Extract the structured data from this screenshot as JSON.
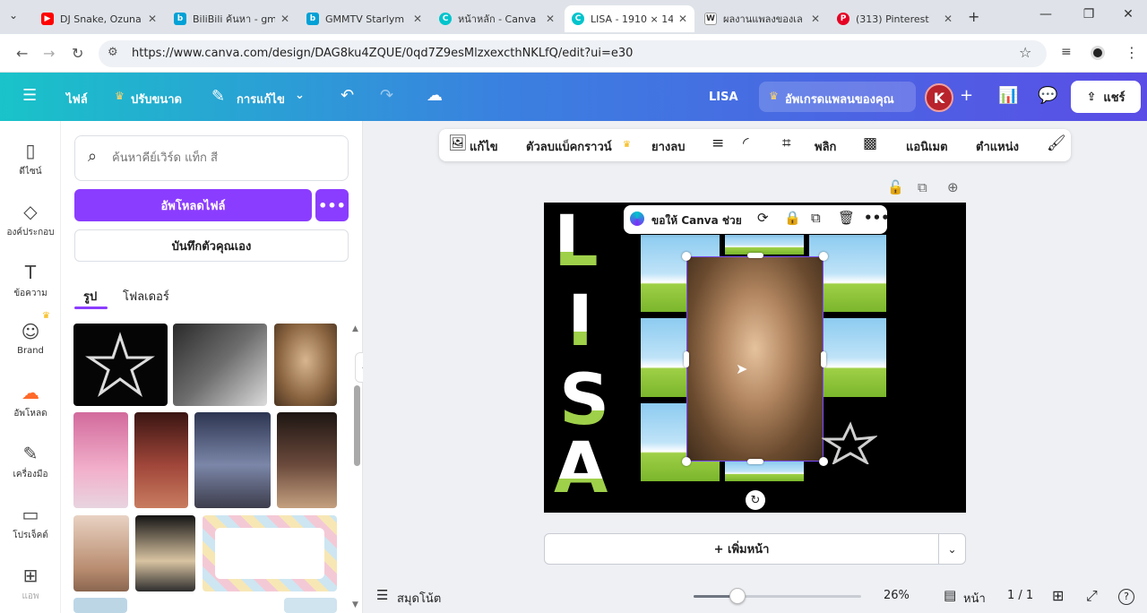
{
  "browser": {
    "tabs": [
      {
        "title": "DJ Snake, Ozuna",
        "color": "#ff0000",
        "glyph": "▶"
      },
      {
        "title": "BiliBili ค้นหา - gm",
        "color": "#00a1d6",
        "glyph": "b"
      },
      {
        "title": "GMMTV Starlym",
        "color": "#00a1d6",
        "glyph": "b"
      },
      {
        "title": "หน้าหลัก - Canva",
        "color": "#00c4cc",
        "glyph": "C"
      },
      {
        "title": "LISA - 1910 × 14",
        "color": "#00c4cc",
        "glyph": "C",
        "active": true
      },
      {
        "title": "ผลงานแพลงของเล",
        "color": "#444444",
        "glyph": "W"
      },
      {
        "title": "(313) Pinterest",
        "color": "#e60023",
        "glyph": "P"
      }
    ],
    "url": "https://www.canva.com/design/DAG8ku4ZQUE/0qd7Z9esMlzxexcthNKLfQ/edit?ui=e30"
  },
  "header": {
    "file": "ไฟล์",
    "resize": "ปรับขนาด",
    "editing": "การแก้ไข",
    "design_title": "LISA",
    "upgrade": "อัพเกรดแพลนของคุณ",
    "avatar_initial": "K",
    "share": "แชร์"
  },
  "rail": [
    {
      "label": "ดีไซน์",
      "icon": "design-icon"
    },
    {
      "label": "องค์ประกอบ",
      "icon": "elements-icon"
    },
    {
      "label": "ข้อความ",
      "icon": "text-icon"
    },
    {
      "label": "Brand",
      "icon": "brand-icon"
    },
    {
      "label": "อัพโหลด",
      "icon": "upload-icon"
    },
    {
      "label": "เครื่องมือ",
      "icon": "tools-icon"
    },
    {
      "label": "โปรเจ็คต์",
      "icon": "projects-icon"
    },
    {
      "label": "แอพ",
      "icon": "apps-icon"
    }
  ],
  "panel": {
    "search_placeholder": "ค้นหาคีย์เวิร์ด แท็ก สี",
    "upload_button": "อัพโหลดไฟล์",
    "record_button": "บันทึกตัวคุณเอง",
    "tabs": [
      "รูป",
      "โฟลเดอร์"
    ]
  },
  "context_toolbar": {
    "edit": "แก้ไข",
    "bg_remover": "ตัวลบแบ็คกราวน์",
    "eraser": "ยางลบ",
    "flip": "พลิก",
    "animate": "แอนิเมต",
    "position": "ตำแหน่ง"
  },
  "canvas": {
    "letters": [
      "L",
      "I",
      "S",
      "A"
    ],
    "floating_bar_label": "ขอให้ Canva ช่วย"
  },
  "add_page": "+ เพิ่มหน้า",
  "bottom": {
    "notes": "สมุดโน้ต",
    "zoom": "26%",
    "zoom_fraction": 0.26,
    "pages_label": "หน้า",
    "page_count": "1 / 1"
  },
  "colors": {
    "accent": "#8b3dff",
    "header_start": "#19c3c9",
    "header_end": "#5a4de6"
  }
}
